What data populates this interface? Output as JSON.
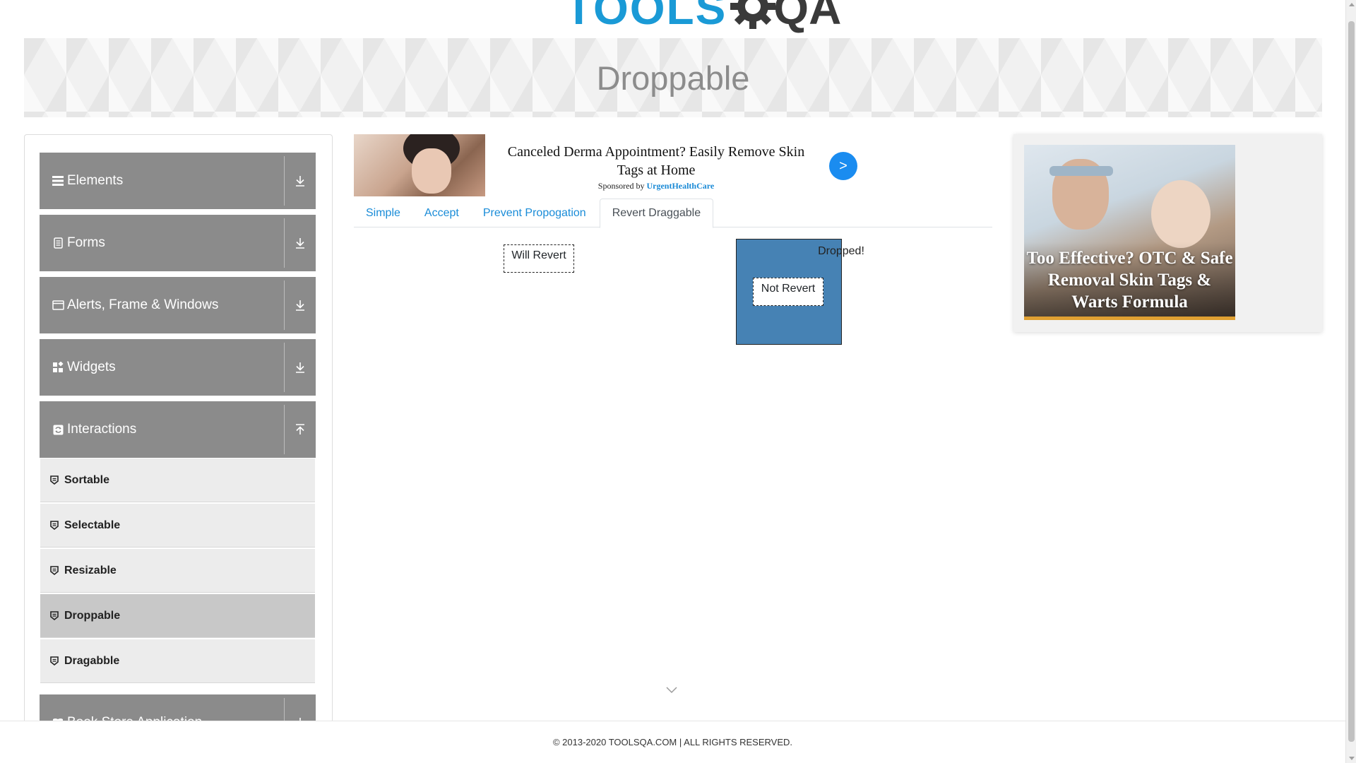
{
  "header": {
    "logo_text_left": "TOOLS",
    "logo_text_right": "QA",
    "logo_colors": {
      "tools": "#1a9ad6",
      "qa": "#3a3a3a"
    }
  },
  "banner": {
    "title": "Droppable"
  },
  "sidebar": {
    "groups": [
      {
        "label": "Elements",
        "icon": "list-icon",
        "toggle": "expand-down-icon"
      },
      {
        "label": "Forms",
        "icon": "document-icon",
        "toggle": "expand-down-icon"
      },
      {
        "label": "Alerts, Frame & Windows",
        "icon": "window-icon",
        "toggle": "expand-down-icon"
      },
      {
        "label": "Widgets",
        "icon": "widgets-icon",
        "toggle": "expand-down-icon"
      },
      {
        "label": "Interactions",
        "icon": "interactions-icon",
        "toggle": "collapse-up-icon"
      },
      {
        "label": "Book Store Application",
        "icon": "book-icon",
        "toggle": "expand-down-icon"
      }
    ],
    "interaction_items": [
      {
        "label": "Sortable",
        "active": false
      },
      {
        "label": "Selectable",
        "active": false
      },
      {
        "label": "Resizable",
        "active": false
      },
      {
        "label": "Droppable",
        "active": true
      },
      {
        "label": "Dragabble",
        "active": false
      }
    ]
  },
  "ad": {
    "title": "Canceled Derma Appointment? Easily Remove Skin Tags at Home",
    "sponsor_prefix": "Sponsored by",
    "sponsor_name": "UrgentHealthCare",
    "arrow": ">"
  },
  "tabs": [
    {
      "label": "Simple",
      "active": false
    },
    {
      "label": "Accept",
      "active": false
    },
    {
      "label": "Prevent Propogation",
      "active": false
    },
    {
      "label": "Revert Draggable",
      "active": true
    }
  ],
  "revert": {
    "will_revert_label": "Will Revert",
    "not_revert_label": "Not Revert",
    "drop_label": "Dropped!",
    "drop_color": "#4682b4"
  },
  "right_ad": {
    "text": "Too Effective? OTC & Safe Removal Skin Tags & Warts Formula"
  },
  "footer": {
    "text": "© 2013-2020 TOOLSQA.COM | ALL RIGHTS RESERVED."
  }
}
